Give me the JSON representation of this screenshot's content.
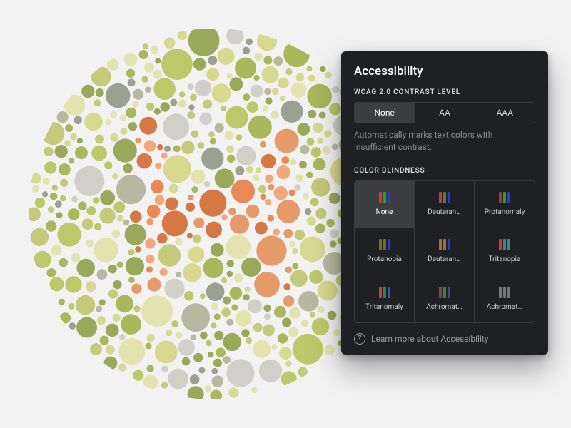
{
  "panel": {
    "title": "Accessibility",
    "contrast": {
      "label": "WCAG 2.0 CONTRAST LEVEL",
      "options": [
        "None",
        "AA",
        "AAA"
      ],
      "selected": 0,
      "hint": "Automatically marks text colors with insufficient contrast."
    },
    "colorblind": {
      "label": "COLOR BLINDNESS",
      "selected": 0,
      "options": [
        {
          "label": "None",
          "bars": [
            "#d23a3a",
            "#2aa02a",
            "#2a3ad2"
          ]
        },
        {
          "label": "Deuteran…",
          "bars": [
            "#c23a3a",
            "#5f7a2a",
            "#2a3ad2"
          ]
        },
        {
          "label": "Protanomaly",
          "bars": [
            "#9e3a3a",
            "#2aa02a",
            "#2a3ad2"
          ]
        },
        {
          "label": "Protanopia",
          "bars": [
            "#7a6a2a",
            "#7a6a2a",
            "#2a3ad2"
          ]
        },
        {
          "label": "Deuteran…",
          "bars": [
            "#b06a2a",
            "#b06a2a",
            "#2a3ad2"
          ]
        },
        {
          "label": "Tritanopia",
          "bars": [
            "#d23a3a",
            "#3a8a8a",
            "#3a8a8a"
          ]
        },
        {
          "label": "Tritanomaly",
          "bars": [
            "#d23a3a",
            "#2a8060",
            "#2a60a0"
          ]
        },
        {
          "label": "Achromat…",
          "bars": [
            "#7a4a4a",
            "#4a7a4a",
            "#4a4a7a"
          ]
        },
        {
          "label": "Achromat…",
          "bars": [
            "#777",
            "#777",
            "#777"
          ]
        }
      ]
    },
    "learn": "Learn more about Accessibility"
  },
  "ishihara": {
    "hidden_letter": "H",
    "palette": {
      "bg_greens": [
        "#bcc96a",
        "#d6d98f",
        "#a8b85a",
        "#c5c97a",
        "#e3e3b0",
        "#9aa85a"
      ],
      "bg_misc": [
        "#b8b8a0",
        "#9ca090",
        "#d0d0c8"
      ],
      "figure": [
        "#e78a55",
        "#d57846",
        "#f0a87a",
        "#e69a6a"
      ]
    }
  }
}
